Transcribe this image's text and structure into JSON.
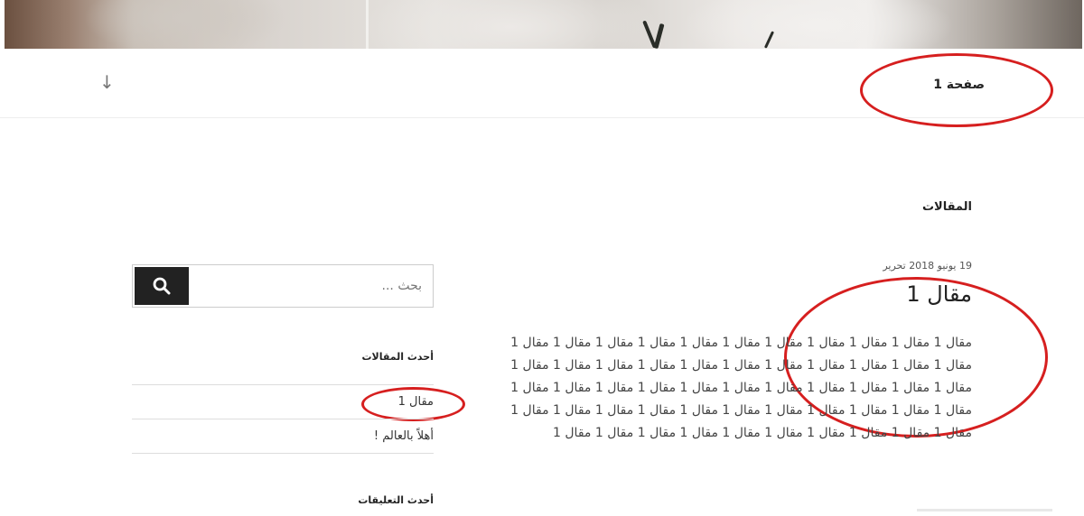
{
  "nav": {
    "menu_toggle_icon": "arrow-down-icon",
    "menu_toggle_glyph": "↓",
    "page_link": "صفحة 1"
  },
  "main": {
    "section_title": "المقالات",
    "post": {
      "meta": "19 يونيو 2018 تحرير",
      "title": "مقال 1",
      "body": "مقال 1 مقال 1 مقال 1 مقال 1 مقال 1 مقال 1 مقال 1 مقال 1 مقال 1 مقال 1 مقال 1 مقال 1 مقال 1 مقال 1 مقال 1 مقال 1 مقال 1 مقال 1 مقال 1 مقال 1 مقال 1 مقال 1 مقال 1 مقال 1 مقال 1 مقال 1 مقال 1 مقال 1 مقال 1 مقال 1 مقال 1 مقال 1 مقال 1 مقال 1 مقال 1 مقال 1 مقال 1 مقال 1 مقال 1 مقال 1 مقال 1 مقال 1 مقال 1 مقال 1 مقال 1 مقال 1 مقال 1 مقال 1 مقال 1 مقال 1 مقال 1 مقال 1 مقال 1 مقال 1"
    }
  },
  "sidebar": {
    "search": {
      "placeholder": "بحث ...",
      "icon": "search-icon"
    },
    "recent_posts_title": "أحدث المقالات",
    "recent_posts": [
      "مقال 1",
      "أهلاً بالعالم !"
    ],
    "recent_comments_title": "أحدث التعليقات"
  },
  "colors": {
    "annotation_ring": "#d61f1f",
    "search_button": "#222222"
  }
}
